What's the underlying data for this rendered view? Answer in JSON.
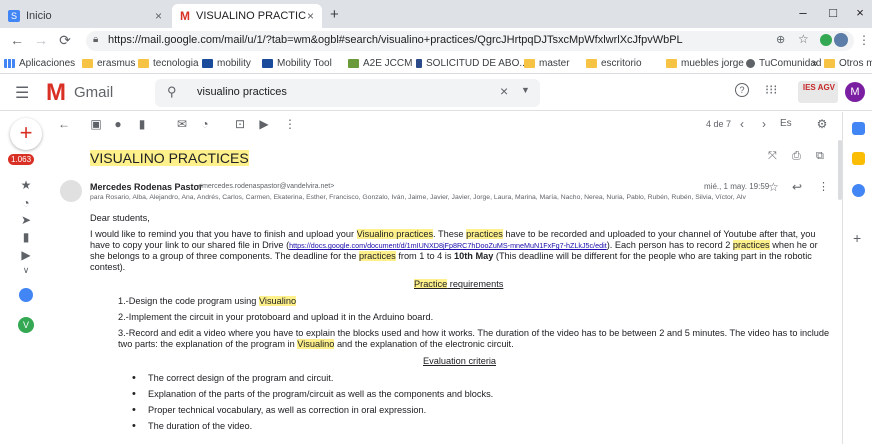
{
  "browser": {
    "tabs": [
      {
        "label": "Inicio",
        "close": "×"
      },
      {
        "label": "VISUALINO PRACTICES - merced",
        "close": "×"
      }
    ],
    "new_tab": "+",
    "window_buttons": [
      "–",
      "□",
      "×"
    ],
    "url": "https://mail.google.com/mail/u/1/?tab=wm&ogbl#search/visualino+practices/QgrcJHrtpqDJTsxcMpWfxlwrlXcJfpvWbPL",
    "bookmarks": [
      "Aplicaciones",
      "erasmus",
      "tecnologia",
      "mobility",
      "Mobility Tool",
      "A2E JCCM",
      "SOLICITUD DE ABO...",
      "master",
      "escritorio",
      "muebles jorge",
      "TuComunidad.com..."
    ],
    "bookmarks_more": "»",
    "other_bookmarks": "Otros marcadores"
  },
  "gmail": {
    "logo_text": "Gmail",
    "search_value": "visualino practices",
    "avatar_letter": "M",
    "ies_badge": "IES AGV",
    "inbox_count": "1.063",
    "rail_avatar_letter": "V",
    "toolbar": {
      "pagination": "4 de 7",
      "lang": "Es"
    }
  },
  "email": {
    "subject": "VISUALINO PRACTICES",
    "sender_name": "Mercedes Rodenas Pastor",
    "sender_email": "<mercedes.rodenaspastor@vandelvira.net>",
    "date": "mié., 1 may. 19:59",
    "recipients": "para Rosario, Alba, Alejandro, Ana, Andrés, Carlos, Carmen, Ekaterina, Esther, Francisco, Gonzalo, Iván, Jaime, Javier, Javier, Jorge, Laura, Marina, María, Nacho, Nerea, Nuria, Pablo, Rubén, Rubén, Silvia, Víctor, Álv",
    "greeting": "Dear students,",
    "para1": {
      "a": "I would like to remind you that you have to finish and upload your ",
      "b": "Visualino practices",
      "c": ". These ",
      "d": "practices",
      "e": " have to be recorded and uploaded to your channel of Youtube after that, you have to copy your link to our shared file in Drive (",
      "link": "https://docs.google.com/document/d/1mIUNXD8jFp8RC7hDooZuMS-mneMuN1FxFg7-hZLkJ5c/edit",
      "f": "). Each person has to record 2 ",
      "g": "practices",
      "h": " when he or she belongs to a group of three components. The deadline for the ",
      "i": "practices",
      "j": " from 1 to 4 is ",
      "bold": "10th May",
      "k": " (This deadline will be different for the people who are taking part in the robotic contest)."
    },
    "req_title_a": "Practice",
    "req_title_b": " requirements",
    "item1_a": "1.-Design the code program using ",
    "item1_b": "Visualino",
    "item2": "2.-Implement the circuit in your protoboard and upload it in the Arduino board.",
    "item3_a": "3.-Record and edit a video where you have to explain the blocks used and how it works. The duration of the video has to be between 2 and 5 minutes. The video has to include two parts: the explanation of the program in ",
    "item3_b": "Visualino",
    "item3_c": " and the explanation of the electronic circuit.",
    "eval_title": "Evaluation criteria",
    "criteria": [
      "The correct design of the program and circuit.",
      "Explanation of the parts of the program/circuit as well as the components and blocks.",
      "Proper technical vocabulary, as well as correction in oral expression.",
      "The duration of the video."
    ]
  },
  "colors": {
    "highlight": "#fef08a",
    "gmail_red": "#d93025",
    "avatar_purple": "#7b1fa2",
    "rail_green": "#34a853"
  }
}
